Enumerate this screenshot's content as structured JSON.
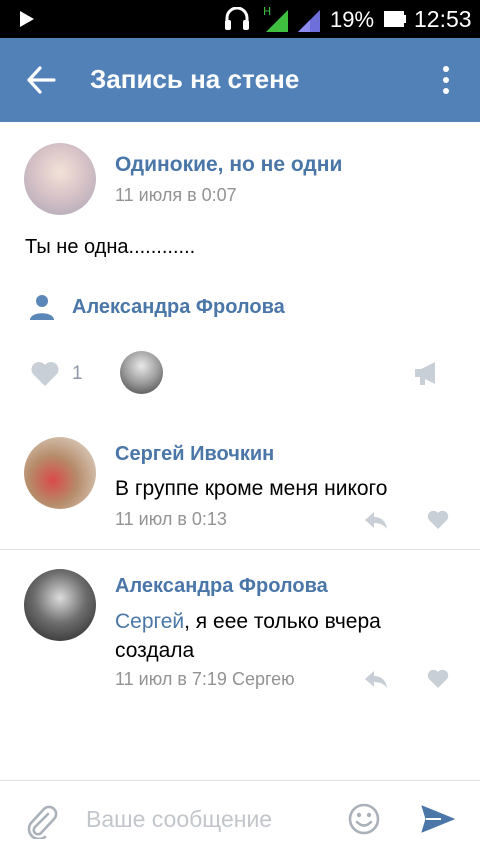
{
  "status_bar": {
    "battery_percent": "19%",
    "time": "12:53",
    "network_label": "H"
  },
  "header": {
    "title": "Запись на стене",
    "back_icon": "arrow-left-icon",
    "menu_icon": "more-vertical-icon"
  },
  "post": {
    "group_name": "Одинокие, но не одни",
    "date": "11 июля в 0:07",
    "text": "Ты не одна............",
    "author": "Александра Фролова",
    "likes_count": "1"
  },
  "comments": [
    {
      "name": "Сергей Ивочкин",
      "text": "В группе кроме меня никого",
      "meta": "11 июл в 0:13"
    },
    {
      "name": "Александра Фролова",
      "mention": "Сергей",
      "text": ", я еее только вчера создала",
      "meta": "11 июл в 7:19 Сергею"
    }
  ],
  "composer": {
    "placeholder": "Ваше сообщение"
  },
  "colors": {
    "header_bg": "#5281b8",
    "link": "#4a76a8",
    "muted": "#939393",
    "icon_gray": "#c8cfd6"
  }
}
